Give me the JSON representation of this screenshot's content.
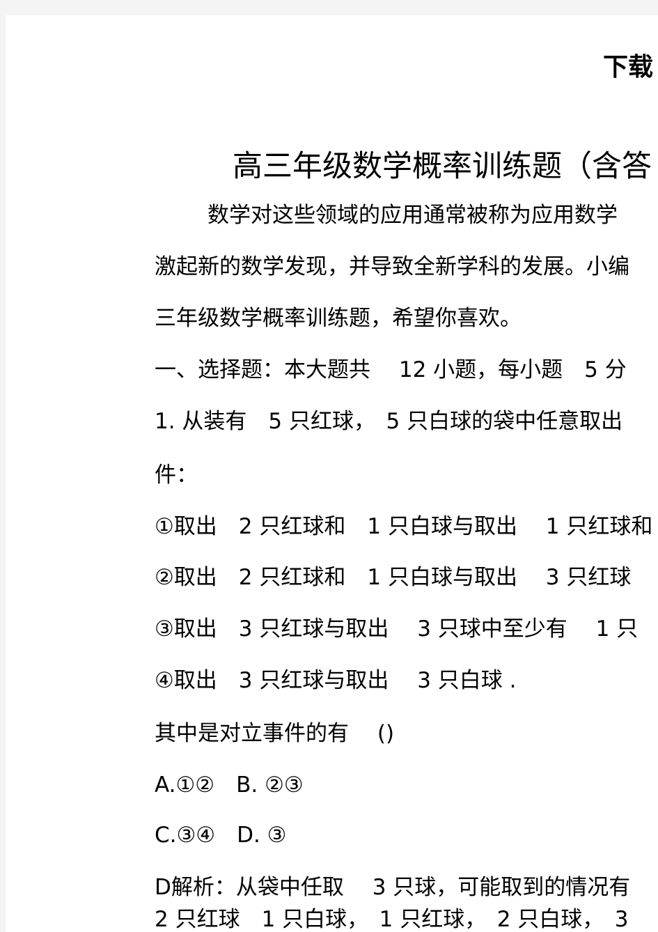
{
  "header": {
    "text": "下载"
  },
  "title": "高三年级数学概率训练题（含答",
  "lines": [
    "数学对这些领域的应用通常被称为应用数学",
    "激起新的数学发现，并导致全新学科的发展。小编",
    "三年级数学概率训练题，希望你喜欢。",
    "一、选择题：本大题共　 12 小题，每小题　5 分",
    "1. 从装有　5 只红球，　5 只白球的袋中任意取出",
    "件：",
    "①取出　2 只红球和　1 只白球与取出　 1 只红球和",
    "②取出　2 只红球和　1 只白球与取出　 3 只红球",
    "③取出　3 只红球与取出　 3 只球中至少有　 1 只",
    "④取出　3 只红球与取出　 3 只白球 .",
    "其中是对立事件的有　 ()",
    "A.①②　B. ②③",
    "C.③④　D. ③",
    "D解析：从袋中任取　 3 只球，可能取到的情况有",
    "2 只红球　1 只白球，　1 只红球，　2 只白球，　3"
  ]
}
